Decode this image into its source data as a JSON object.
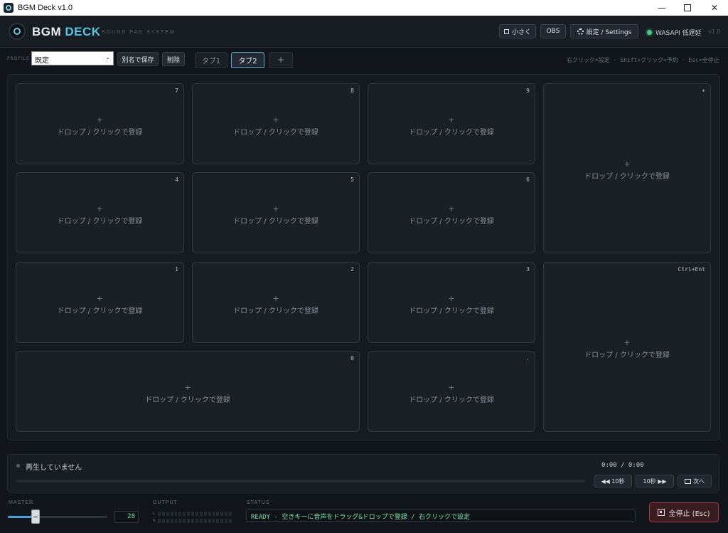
{
  "window": {
    "title": "BGM Deck v1.0",
    "min": "—",
    "close": "✕"
  },
  "header": {
    "brand_main": "BGM",
    "brand_accent": "DECK",
    "tagline": "SOUND PAD SYSTEM",
    "small_label": "小さく",
    "obs_label": "OBS",
    "settings_label": "設定 / Settings",
    "audio_status": "WASAPI 低遅延",
    "version": "v1.0"
  },
  "profile": {
    "label": "PROFILE",
    "selected": "既定",
    "save_as": "別名で保存",
    "delete": "削除"
  },
  "tabs": [
    {
      "label": "タブ1",
      "active": false
    },
    {
      "label": "タブ2",
      "active": true
    },
    {
      "label": "+",
      "active": false
    }
  ],
  "hint": "右クリック=設定 · Shift+クリック=予約 · Esc=全停止",
  "pads": {
    "empty_plus": "+",
    "empty_label": "ドロップ / クリックで登録",
    "items": [
      {
        "key": "7"
      },
      {
        "key": "8"
      },
      {
        "key": "9"
      },
      {
        "key": "+"
      },
      {
        "key": "4"
      },
      {
        "key": "5"
      },
      {
        "key": "6"
      },
      {
        "key": "1"
      },
      {
        "key": "2"
      },
      {
        "key": "3"
      },
      {
        "key": "Ctrl+Ent"
      },
      {
        "key": "0"
      },
      {
        "key": "."
      }
    ]
  },
  "now_playing": {
    "status": "再生していません",
    "time": "0:00 / 0:00",
    "progress": 0,
    "back_label": "◀◀ 10秒",
    "fwd_label": "10秒 ▶▶",
    "next_label": "次へ"
  },
  "bottom": {
    "master_label": "MASTER",
    "master_value": "28",
    "master_level": 0.28,
    "output_label": "OUTPUT",
    "meter_l": "L",
    "meter_r": "R",
    "status_label": "STATUS",
    "status_text": "READY - 空きキーに音声をドラッグ&ドロップで登録 / 右クリックで設定",
    "stop_label": "全停止 (Esc)"
  },
  "colors": {
    "accent": "#57c7e0",
    "status_green": "#3ed07a",
    "readout": "#7fe0a0",
    "stop": "#a13c43"
  }
}
